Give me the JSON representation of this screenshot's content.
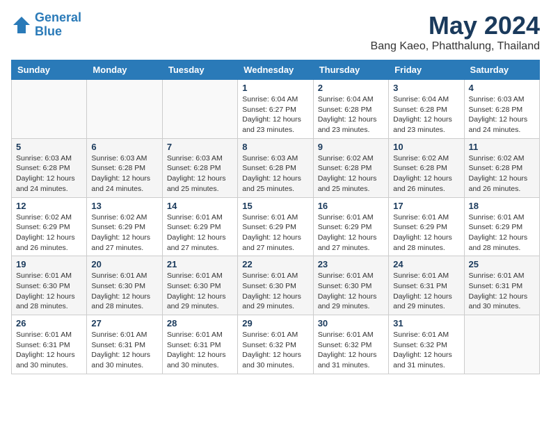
{
  "logo": {
    "line1": "General",
    "line2": "Blue"
  },
  "title": "May 2024",
  "subtitle": "Bang Kaeo, Phatthalung, Thailand",
  "weekdays": [
    "Sunday",
    "Monday",
    "Tuesday",
    "Wednesday",
    "Thursday",
    "Friday",
    "Saturday"
  ],
  "weeks": [
    [
      {
        "day": "",
        "info": ""
      },
      {
        "day": "",
        "info": ""
      },
      {
        "day": "",
        "info": ""
      },
      {
        "day": "1",
        "info": "Sunrise: 6:04 AM\nSunset: 6:27 PM\nDaylight: 12 hours\nand 23 minutes."
      },
      {
        "day": "2",
        "info": "Sunrise: 6:04 AM\nSunset: 6:28 PM\nDaylight: 12 hours\nand 23 minutes."
      },
      {
        "day": "3",
        "info": "Sunrise: 6:04 AM\nSunset: 6:28 PM\nDaylight: 12 hours\nand 23 minutes."
      },
      {
        "day": "4",
        "info": "Sunrise: 6:03 AM\nSunset: 6:28 PM\nDaylight: 12 hours\nand 24 minutes."
      }
    ],
    [
      {
        "day": "5",
        "info": "Sunrise: 6:03 AM\nSunset: 6:28 PM\nDaylight: 12 hours\nand 24 minutes."
      },
      {
        "day": "6",
        "info": "Sunrise: 6:03 AM\nSunset: 6:28 PM\nDaylight: 12 hours\nand 24 minutes."
      },
      {
        "day": "7",
        "info": "Sunrise: 6:03 AM\nSunset: 6:28 PM\nDaylight: 12 hours\nand 25 minutes."
      },
      {
        "day": "8",
        "info": "Sunrise: 6:03 AM\nSunset: 6:28 PM\nDaylight: 12 hours\nand 25 minutes."
      },
      {
        "day": "9",
        "info": "Sunrise: 6:02 AM\nSunset: 6:28 PM\nDaylight: 12 hours\nand 25 minutes."
      },
      {
        "day": "10",
        "info": "Sunrise: 6:02 AM\nSunset: 6:28 PM\nDaylight: 12 hours\nand 26 minutes."
      },
      {
        "day": "11",
        "info": "Sunrise: 6:02 AM\nSunset: 6:28 PM\nDaylight: 12 hours\nand 26 minutes."
      }
    ],
    [
      {
        "day": "12",
        "info": "Sunrise: 6:02 AM\nSunset: 6:29 PM\nDaylight: 12 hours\nand 26 minutes."
      },
      {
        "day": "13",
        "info": "Sunrise: 6:02 AM\nSunset: 6:29 PM\nDaylight: 12 hours\nand 27 minutes."
      },
      {
        "day": "14",
        "info": "Sunrise: 6:01 AM\nSunset: 6:29 PM\nDaylight: 12 hours\nand 27 minutes."
      },
      {
        "day": "15",
        "info": "Sunrise: 6:01 AM\nSunset: 6:29 PM\nDaylight: 12 hours\nand 27 minutes."
      },
      {
        "day": "16",
        "info": "Sunrise: 6:01 AM\nSunset: 6:29 PM\nDaylight: 12 hours\nand 27 minutes."
      },
      {
        "day": "17",
        "info": "Sunrise: 6:01 AM\nSunset: 6:29 PM\nDaylight: 12 hours\nand 28 minutes."
      },
      {
        "day": "18",
        "info": "Sunrise: 6:01 AM\nSunset: 6:29 PM\nDaylight: 12 hours\nand 28 minutes."
      }
    ],
    [
      {
        "day": "19",
        "info": "Sunrise: 6:01 AM\nSunset: 6:30 PM\nDaylight: 12 hours\nand 28 minutes."
      },
      {
        "day": "20",
        "info": "Sunrise: 6:01 AM\nSunset: 6:30 PM\nDaylight: 12 hours\nand 28 minutes."
      },
      {
        "day": "21",
        "info": "Sunrise: 6:01 AM\nSunset: 6:30 PM\nDaylight: 12 hours\nand 29 minutes."
      },
      {
        "day": "22",
        "info": "Sunrise: 6:01 AM\nSunset: 6:30 PM\nDaylight: 12 hours\nand 29 minutes."
      },
      {
        "day": "23",
        "info": "Sunrise: 6:01 AM\nSunset: 6:30 PM\nDaylight: 12 hours\nand 29 minutes."
      },
      {
        "day": "24",
        "info": "Sunrise: 6:01 AM\nSunset: 6:31 PM\nDaylight: 12 hours\nand 29 minutes."
      },
      {
        "day": "25",
        "info": "Sunrise: 6:01 AM\nSunset: 6:31 PM\nDaylight: 12 hours\nand 30 minutes."
      }
    ],
    [
      {
        "day": "26",
        "info": "Sunrise: 6:01 AM\nSunset: 6:31 PM\nDaylight: 12 hours\nand 30 minutes."
      },
      {
        "day": "27",
        "info": "Sunrise: 6:01 AM\nSunset: 6:31 PM\nDaylight: 12 hours\nand 30 minutes."
      },
      {
        "day": "28",
        "info": "Sunrise: 6:01 AM\nSunset: 6:31 PM\nDaylight: 12 hours\nand 30 minutes."
      },
      {
        "day": "29",
        "info": "Sunrise: 6:01 AM\nSunset: 6:32 PM\nDaylight: 12 hours\nand 30 minutes."
      },
      {
        "day": "30",
        "info": "Sunrise: 6:01 AM\nSunset: 6:32 PM\nDaylight: 12 hours\nand 31 minutes."
      },
      {
        "day": "31",
        "info": "Sunrise: 6:01 AM\nSunset: 6:32 PM\nDaylight: 12 hours\nand 31 minutes."
      },
      {
        "day": "",
        "info": ""
      }
    ]
  ]
}
